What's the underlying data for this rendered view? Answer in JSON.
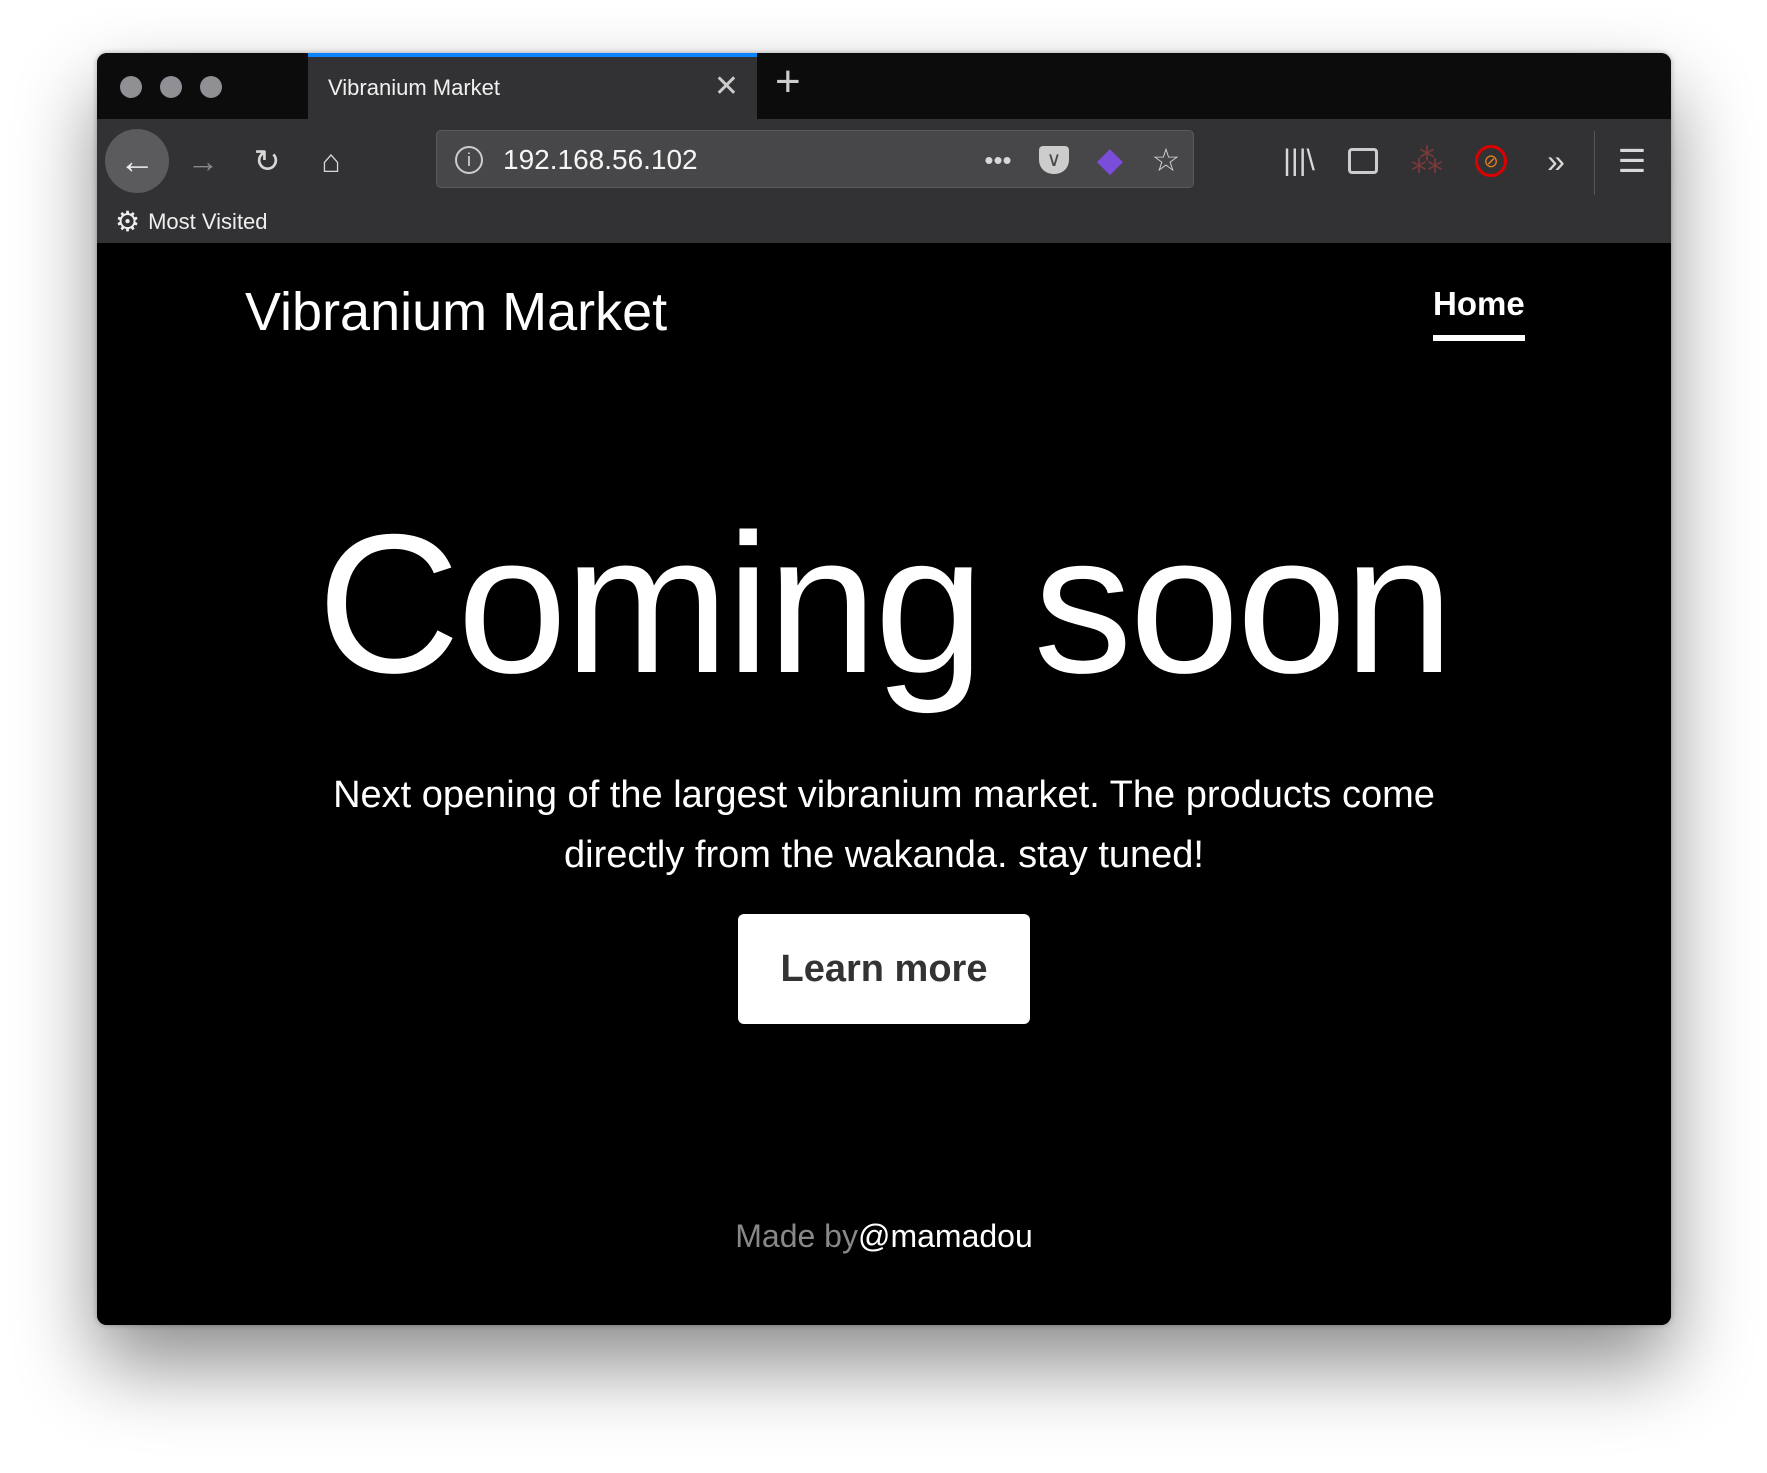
{
  "browser": {
    "tab_title": "Vibranium Market",
    "url": "192.168.56.102",
    "bookmarks": [
      {
        "label": "Most Visited",
        "icon": "gear-icon"
      }
    ],
    "accent_color": "#0a84ff"
  },
  "site": {
    "brand": "Vibranium Market",
    "nav": [
      {
        "label": "Home",
        "active": true
      }
    ],
    "hero_title": "Coming soon",
    "lead": "Next opening of the largest vibranium market. The products come directly from the wakanda. stay tuned!",
    "cta_label": "Learn more",
    "footer_prefix": "Made by",
    "footer_author": "@mamadou"
  }
}
